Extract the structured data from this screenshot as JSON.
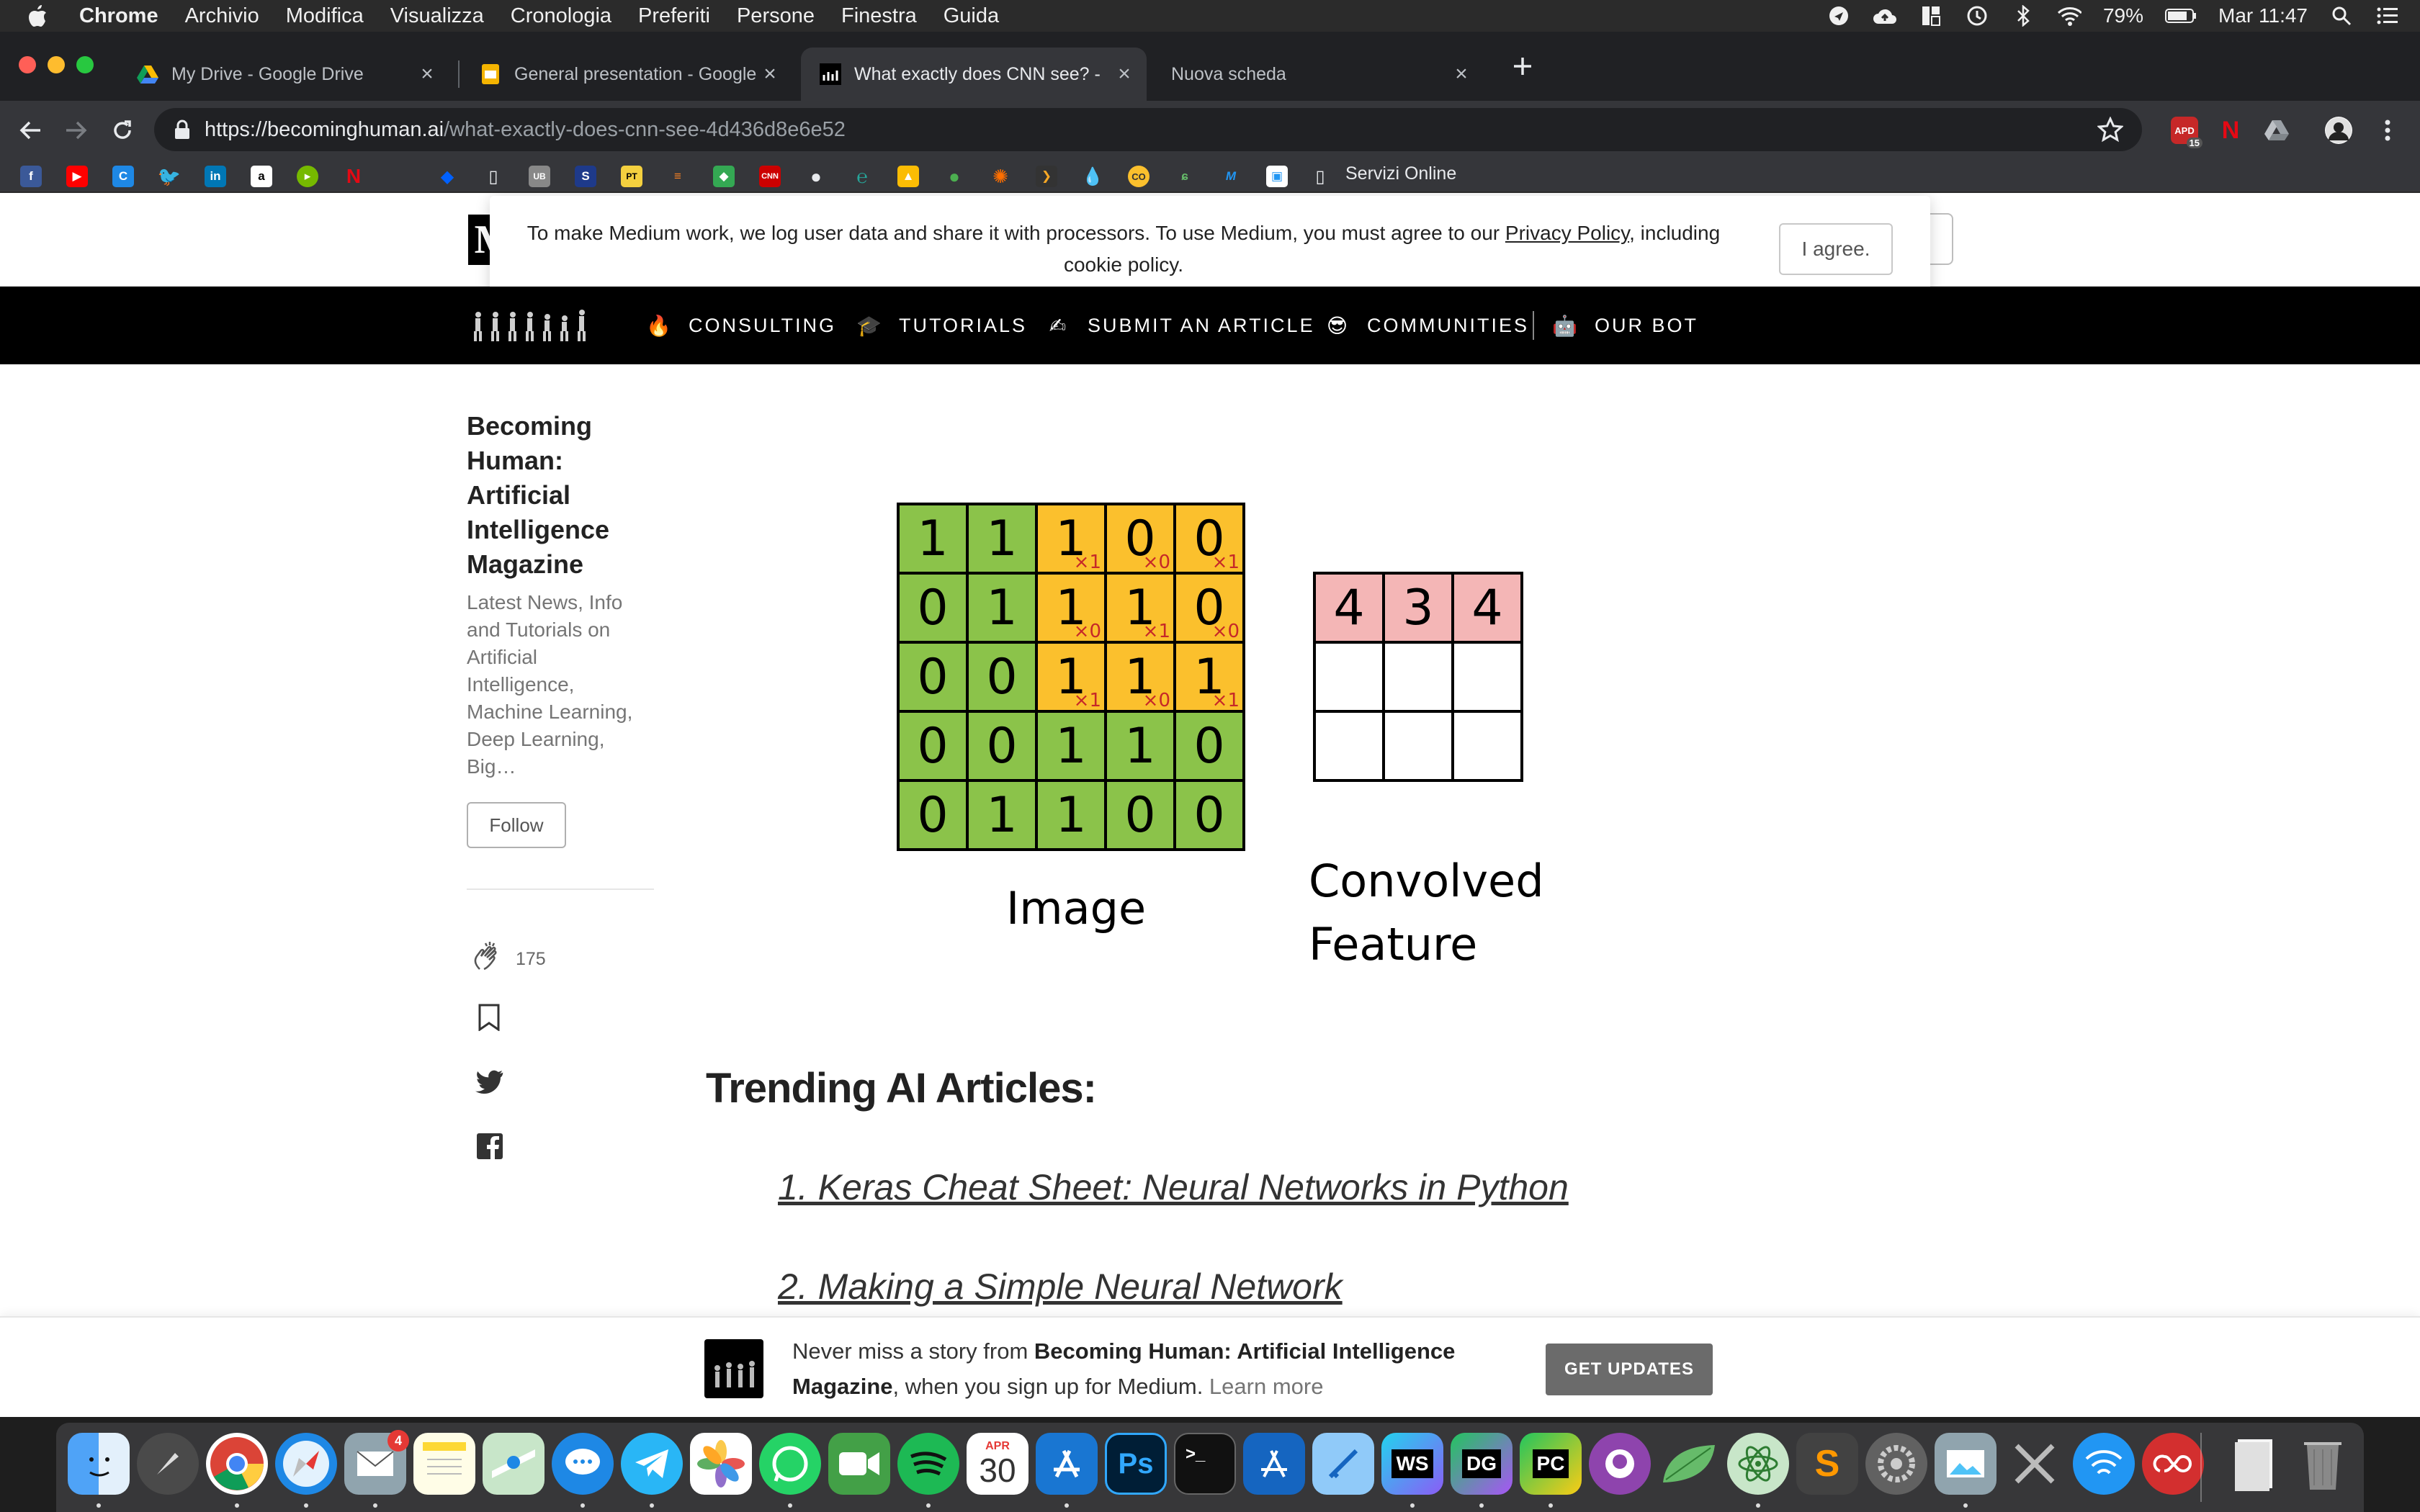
{
  "menubar": {
    "app": "Chrome",
    "items": [
      "Archivio",
      "Modifica",
      "Visualizza",
      "Cronologia",
      "Preferiti",
      "Persone",
      "Finestra",
      "Guida"
    ],
    "battery": "79%",
    "clock": "Mar 11:47"
  },
  "tabs": [
    {
      "title": "My Drive - Google Drive",
      "icon": "google-drive-icon"
    },
    {
      "title": "General presentation - Google",
      "icon": "google-slides-icon"
    },
    {
      "title": "What exactly does CNN see? -",
      "icon": "becoming-human-icon",
      "active": true
    },
    {
      "title": "Nuova scheda",
      "icon": "none"
    }
  ],
  "omnibox": {
    "url_host": "https://becominghuman.ai",
    "url_path": "/what-exactly-does-cnn-see-4d436d8e6e52"
  },
  "extensions": {
    "apd_badge": "15",
    "apd_label": "APD"
  },
  "bookmarks": {
    "last_label": "Servizi Online"
  },
  "cookie_banner": {
    "text_before": "To make Medium work, we log user data and share it with processors. To use Medium, you must agree to our ",
    "link": "Privacy Policy",
    "text_after": ", including cookie policy.",
    "button": "I agree."
  },
  "pub_nav": {
    "items": [
      {
        "emoji": "🔥",
        "label": "CONSULTING"
      },
      {
        "emoji": "🎓",
        "label": "TUTORIALS"
      },
      {
        "emoji": "✍",
        "label": "SUBMIT AN ARTICLE"
      },
      {
        "emoji": "😎",
        "label": "COMMUNITIES"
      },
      {
        "emoji": "🤖",
        "label": "OUR BOT"
      }
    ]
  },
  "sidebar": {
    "pub_name": "Becoming Human: Artificial Intelligence Magazine",
    "pub_desc": "Latest News, Info and Tutorials on Artificial Intelligence, Machine Learning, Deep Learning, Big…",
    "follow": "Follow",
    "claps": "175"
  },
  "figure": {
    "image_grid": [
      [
        "1",
        "1",
        "1",
        "0",
        "0"
      ],
      [
        "0",
        "1",
        "1",
        "1",
        "0"
      ],
      [
        "0",
        "0",
        "1",
        "1",
        "1"
      ],
      [
        "0",
        "0",
        "1",
        "1",
        "0"
      ],
      [
        "0",
        "1",
        "1",
        "0",
        "0"
      ]
    ],
    "kernel_subscripts": [
      [
        "×1",
        "×0",
        "×1"
      ],
      [
        "×0",
        "×1",
        "×0"
      ],
      [
        "×1",
        "×0",
        "×1"
      ]
    ],
    "kernel_position": {
      "row": 0,
      "col": 2
    },
    "conv_grid": [
      [
        "4",
        "3",
        "4"
      ],
      [
        "",
        "",
        ""
      ],
      [
        "",
        "",
        ""
      ]
    ],
    "image_caption": "Image",
    "conv_caption_line1": "Convolved",
    "conv_caption_line2": "Feature",
    "colors": {
      "green": "#8bc34a",
      "orange": "#fbc02d",
      "pink": "#f4b6b6"
    }
  },
  "article": {
    "trending_heading": "Trending AI Articles:",
    "links": [
      "1. Keras Cheat Sheet: Neural Networks in Python",
      "2. Making a Simple Neural Network"
    ]
  },
  "updates_bar": {
    "text_before": "Never miss a story from ",
    "pub": "Becoming Human: Artificial Intelligence Magazine",
    "text_after": ", when you sign up for Medium. ",
    "learn_more": "Learn more",
    "button": "GET UPDATES"
  },
  "dock": {
    "mail_badge": "4",
    "calendar_month": "APR",
    "calendar_day": "30"
  }
}
